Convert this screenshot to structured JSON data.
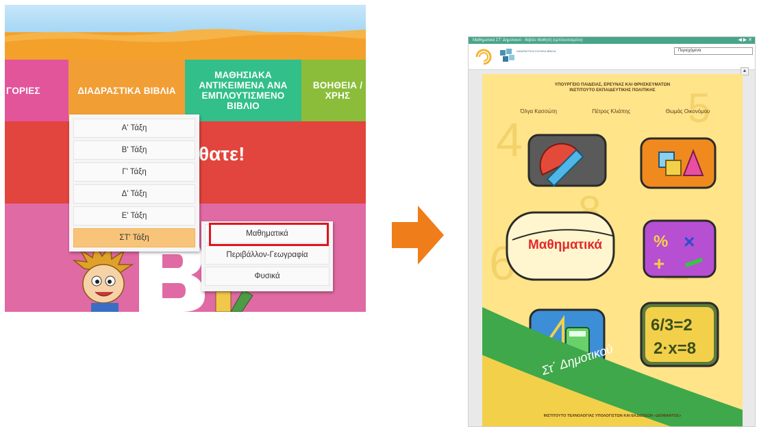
{
  "left_panel": {
    "nav": {
      "categories": "ΓΟΡΙΕΣ",
      "interactive_books": "ΔΙΑΔΡΑΣΤΙΚΑ ΒΙΒΛΙΑ",
      "learning_objects": "ΜΑΘΗΣΙΑΚΑ ΑΝΤΙΚΕΙΜΕΝΑ ΑΝΑ ΕΜΠΛΟΥΤΙΣΜΕΝΟ ΒΙΒΛΙΟ",
      "help": "ΒΟΗΘΕΙΑ / ΧΡΗΣ"
    },
    "banner_text": "θατε!",
    "grades": [
      "Α' Τάξη",
      "Β' Τάξη",
      "Γ' Τάξη",
      "Δ' Τάξη",
      "Ε' Τάξη",
      "ΣΤ' Τάξη"
    ],
    "active_grade_index": 5,
    "subjects": [
      "Μαθηματικά",
      "Περιβάλλον-Γεωγραφία",
      "Φυσικά"
    ],
    "highlighted_subject": "Μαθηματικά"
  },
  "arrow": {
    "color": "#ef7d19"
  },
  "right_panel": {
    "window_title": "Μαθηματικά ΣΤ' Δημοτικού - Βιβλίο Μαθητή (εμπλουτισμένο)",
    "title_buttons": "◀ ▶ ✕",
    "publisher_logo_text": "ΔΙΑΔΡΑΣΤΙΚΑ ΣΧΟΛΙΚΑ ΒΙΒΛΙΑ",
    "search_label": "Περιεχόμενα",
    "scroll_up": "▲",
    "cover": {
      "ministry_line1": "ΥΠΟΥΡΓΕΙΟ ΠΑΙΔΕΙΑΣ, ΕΡΕΥΝΑΣ ΚΑΙ ΘΡΗΣΚΕΥΜΑΤΩΝ",
      "ministry_line2": "ΙΝΣΤΙΤΟΥΤΟ ΕΚΠΑΙΔΕΥΤΙΚΗΣ ΠΟΛΙΤΙΚΗΣ",
      "authors": [
        "Όλγα Κασσώτη",
        "Πέτρος Κλιάπης",
        "Θωμάς Οικονόμου"
      ],
      "subject": "Μαθηματικά",
      "equation_1": "6/3=2",
      "equation_2": "2·x=8",
      "grade": "Στ΄ Δημοτικού",
      "publisher": "ΙΝΣΤΙΤΟΥΤΟ ΤΕΧΝΟΛΟΓΙΑΣ ΥΠΟΛΟΓΙΣΤΩΝ ΚΑΙ ΕΚΔΟΣΕΩΝ «ΔΙΟΦΑΝΤΟΣ»"
    }
  }
}
